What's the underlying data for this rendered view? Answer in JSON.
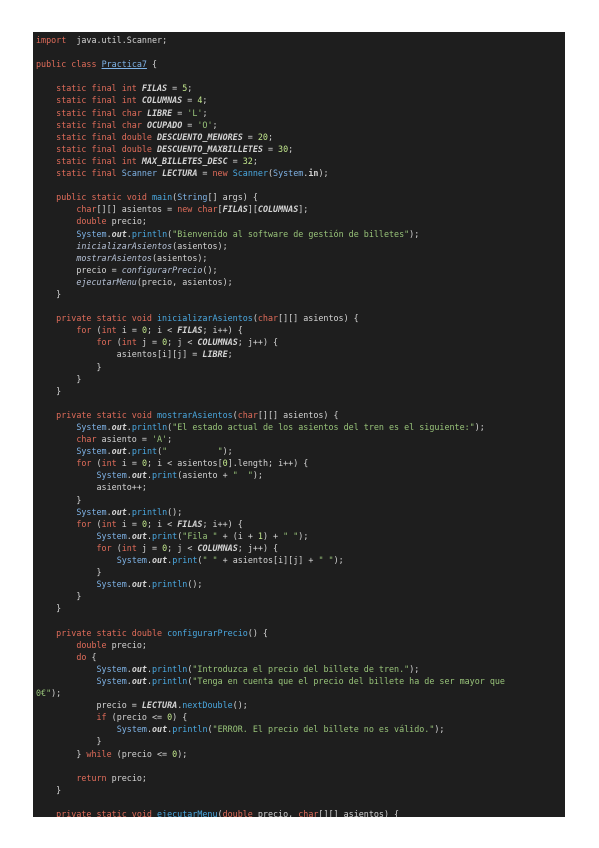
{
  "editor": {
    "language": "java",
    "colors": {
      "background": "#1e1e1e",
      "keyword": "#e06c5a",
      "string": "#98c379",
      "number": "#c3e88d",
      "method": "#4aa8e0",
      "class": "#7fb3e6",
      "plain": "#d4d4d4"
    },
    "lines": [
      [
        [
          "kw",
          "import"
        ],
        [
          "",
          "  java.util.Scanner;"
        ]
      ],
      [],
      [
        [
          "kw",
          "public class "
        ],
        [
          "cls ul",
          "Practica7"
        ],
        [
          "",
          " {"
        ]
      ],
      [],
      [
        [
          "",
          "    "
        ],
        [
          "kw",
          "static final int "
        ],
        [
          "cst",
          "FILAS"
        ],
        [
          "",
          " = "
        ],
        [
          "num",
          "5"
        ],
        [
          "",
          ";"
        ]
      ],
      [
        [
          "",
          "    "
        ],
        [
          "kw",
          "static final int "
        ],
        [
          "cst",
          "COLUMNAS"
        ],
        [
          "",
          " = "
        ],
        [
          "num",
          "4"
        ],
        [
          "",
          ";"
        ]
      ],
      [
        [
          "",
          "    "
        ],
        [
          "kw",
          "static final char "
        ],
        [
          "cst",
          "LIBRE"
        ],
        [
          "",
          " = "
        ],
        [
          "str",
          "'L'"
        ],
        [
          "",
          ";"
        ]
      ],
      [
        [
          "",
          "    "
        ],
        [
          "kw",
          "static final char "
        ],
        [
          "cst",
          "OCUPADO"
        ],
        [
          "",
          " = "
        ],
        [
          "str",
          "'O'"
        ],
        [
          "",
          ";"
        ]
      ],
      [
        [
          "",
          "    "
        ],
        [
          "kw",
          "static final double "
        ],
        [
          "cst",
          "DESCUENTO_MENORES"
        ],
        [
          "",
          " = "
        ],
        [
          "num",
          "20"
        ],
        [
          "",
          ";"
        ]
      ],
      [
        [
          "",
          "    "
        ],
        [
          "kw",
          "static final double "
        ],
        [
          "cst",
          "DESCUENTO_MAXBILLETES"
        ],
        [
          "",
          " = "
        ],
        [
          "num",
          "30"
        ],
        [
          "",
          ";"
        ]
      ],
      [
        [
          "",
          "    "
        ],
        [
          "kw",
          "static final int "
        ],
        [
          "cst",
          "MAX_BILLETES_DESC"
        ],
        [
          "",
          " = "
        ],
        [
          "num",
          "32"
        ],
        [
          "",
          ";"
        ]
      ],
      [
        [
          "",
          "    "
        ],
        [
          "kw",
          "static final "
        ],
        [
          "cls",
          "Scanner"
        ],
        [
          "cst",
          " LECTURA"
        ],
        [
          "",
          " = "
        ],
        [
          "kw",
          "new "
        ],
        [
          "fn",
          "Scanner"
        ],
        [
          "",
          "("
        ],
        [
          "cls",
          "System"
        ],
        [
          "",
          "."
        ],
        [
          "bold",
          "in"
        ],
        [
          "",
          ");"
        ]
      ],
      [],
      [
        [
          "",
          "    "
        ],
        [
          "kw",
          "public static void "
        ],
        [
          "fn",
          "main"
        ],
        [
          "",
          "("
        ],
        [
          "cls",
          "String"
        ],
        [
          "",
          "[] args) {"
        ]
      ],
      [
        [
          "",
          "        "
        ],
        [
          "ty",
          "char"
        ],
        [
          "",
          "[][] asientos = "
        ],
        [
          "kw",
          "new "
        ],
        [
          "ty",
          "char"
        ],
        [
          "",
          "["
        ],
        [
          "cst",
          "FILAS"
        ],
        [
          "",
          "]["
        ],
        [
          "cst",
          "COLUMNAS"
        ],
        [
          "",
          "];"
        ]
      ],
      [
        [
          "",
          "        "
        ],
        [
          "ty",
          "double"
        ],
        [
          "",
          " precio;"
        ]
      ],
      [
        [
          "",
          "        "
        ],
        [
          "cls",
          "System"
        ],
        [
          "",
          "."
        ],
        [
          "cst",
          "out"
        ],
        [
          "",
          "."
        ],
        [
          "fn",
          "println"
        ],
        [
          "",
          "("
        ],
        [
          "str",
          "\"Bienvenido al software de gestión de billetes\""
        ],
        [
          "",
          ");"
        ]
      ],
      [
        [
          "",
          "        "
        ],
        [
          "fni",
          "inicializarAsientos"
        ],
        [
          "",
          "(asientos);"
        ]
      ],
      [
        [
          "",
          "        "
        ],
        [
          "fni",
          "mostrarAsientos"
        ],
        [
          "",
          "(asientos);"
        ]
      ],
      [
        [
          "",
          "        precio = "
        ],
        [
          "fni",
          "configurarPrecio"
        ],
        [
          "",
          "();"
        ]
      ],
      [
        [
          "",
          "        "
        ],
        [
          "fni",
          "ejecutarMenu"
        ],
        [
          "",
          "(precio, asientos);"
        ]
      ],
      [
        [
          "",
          "    }"
        ]
      ],
      [],
      [
        [
          "",
          "    "
        ],
        [
          "kw",
          "private static void "
        ],
        [
          "fn",
          "inicializarAsientos"
        ],
        [
          "",
          "("
        ],
        [
          "ty",
          "char"
        ],
        [
          "",
          "[][] asientos) {"
        ]
      ],
      [
        [
          "",
          "        "
        ],
        [
          "kw",
          "for"
        ],
        [
          "",
          " ("
        ],
        [
          "ty",
          "int"
        ],
        [
          "",
          " i = "
        ],
        [
          "num",
          "0"
        ],
        [
          "",
          "; i < "
        ],
        [
          "cst",
          "FILAS"
        ],
        [
          "",
          "; i++) {"
        ]
      ],
      [
        [
          "",
          "            "
        ],
        [
          "kw",
          "for"
        ],
        [
          "",
          " ("
        ],
        [
          "ty",
          "int"
        ],
        [
          "",
          " j = "
        ],
        [
          "num",
          "0"
        ],
        [
          "",
          "; j < "
        ],
        [
          "cst",
          "COLUMNAS"
        ],
        [
          "",
          "; j++) {"
        ]
      ],
      [
        [
          "",
          "                asientos[i][j] = "
        ],
        [
          "cst",
          "LIBRE"
        ],
        [
          "",
          ";"
        ]
      ],
      [
        [
          "",
          "            }"
        ]
      ],
      [
        [
          "",
          "        }"
        ]
      ],
      [
        [
          "",
          "    }"
        ]
      ],
      [],
      [
        [
          "",
          "    "
        ],
        [
          "kw",
          "private static void "
        ],
        [
          "fn",
          "mostrarAsientos"
        ],
        [
          "",
          "("
        ],
        [
          "ty",
          "char"
        ],
        [
          "",
          "[][] asientos) {"
        ]
      ],
      [
        [
          "",
          "        "
        ],
        [
          "cls",
          "System"
        ],
        [
          "",
          "."
        ],
        [
          "cst",
          "out"
        ],
        [
          "",
          "."
        ],
        [
          "fn",
          "println"
        ],
        [
          "",
          "("
        ],
        [
          "str",
          "\"El estado actual de los asientos del tren es el siguiente:\""
        ],
        [
          "",
          ");"
        ]
      ],
      [
        [
          "",
          "        "
        ],
        [
          "ty",
          "char"
        ],
        [
          "",
          " asiento = "
        ],
        [
          "str",
          "'A'"
        ],
        [
          "",
          ";"
        ]
      ],
      [
        [
          "",
          "        "
        ],
        [
          "cls",
          "System"
        ],
        [
          "",
          "."
        ],
        [
          "cst",
          "out"
        ],
        [
          "",
          "."
        ],
        [
          "fn",
          "print"
        ],
        [
          "",
          "("
        ],
        [
          "str",
          "\"          \""
        ],
        [
          "",
          ");"
        ]
      ],
      [
        [
          "",
          "        "
        ],
        [
          "kw",
          "for"
        ],
        [
          "",
          " ("
        ],
        [
          "ty",
          "int"
        ],
        [
          "",
          " i = "
        ],
        [
          "num",
          "0"
        ],
        [
          "",
          "; i < asientos["
        ],
        [
          "num",
          "0"
        ],
        [
          "",
          "].length; i++) {"
        ]
      ],
      [
        [
          "",
          "            "
        ],
        [
          "cls",
          "System"
        ],
        [
          "",
          "."
        ],
        [
          "cst",
          "out"
        ],
        [
          "",
          "."
        ],
        [
          "fn",
          "print"
        ],
        [
          "",
          "(asiento + "
        ],
        [
          "str",
          "\"  \""
        ],
        [
          "",
          ");"
        ]
      ],
      [
        [
          "",
          "            asiento++;"
        ]
      ],
      [
        [
          "",
          "        }"
        ]
      ],
      [
        [
          "",
          "        "
        ],
        [
          "cls",
          "System"
        ],
        [
          "",
          "."
        ],
        [
          "cst",
          "out"
        ],
        [
          "",
          "."
        ],
        [
          "fn",
          "println"
        ],
        [
          "",
          "();"
        ]
      ],
      [
        [
          "",
          "        "
        ],
        [
          "kw",
          "for"
        ],
        [
          "",
          " ("
        ],
        [
          "ty",
          "int"
        ],
        [
          "",
          " i = "
        ],
        [
          "num",
          "0"
        ],
        [
          "",
          "; i < "
        ],
        [
          "cst",
          "FILAS"
        ],
        [
          "",
          "; i++) {"
        ]
      ],
      [
        [
          "",
          "            "
        ],
        [
          "cls",
          "System"
        ],
        [
          "",
          "."
        ],
        [
          "cst",
          "out"
        ],
        [
          "",
          "."
        ],
        [
          "fn",
          "print"
        ],
        [
          "",
          "("
        ],
        [
          "str",
          "\"Fila \""
        ],
        [
          "",
          " + (i + "
        ],
        [
          "num",
          "1"
        ],
        [
          "",
          ") + "
        ],
        [
          "str",
          "\" \""
        ],
        [
          "",
          ");"
        ]
      ],
      [
        [
          "",
          "            "
        ],
        [
          "kw",
          "for"
        ],
        [
          "",
          " ("
        ],
        [
          "ty",
          "int"
        ],
        [
          "",
          " j = "
        ],
        [
          "num",
          "0"
        ],
        [
          "",
          "; j < "
        ],
        [
          "cst",
          "COLUMNAS"
        ],
        [
          "",
          "; j++) {"
        ]
      ],
      [
        [
          "",
          "                "
        ],
        [
          "cls",
          "System"
        ],
        [
          "",
          "."
        ],
        [
          "cst",
          "out"
        ],
        [
          "",
          "."
        ],
        [
          "fn",
          "print"
        ],
        [
          "",
          "("
        ],
        [
          "str",
          "\" \""
        ],
        [
          "",
          " + asientos[i][j] + "
        ],
        [
          "str",
          "\" \""
        ],
        [
          "",
          ");"
        ]
      ],
      [
        [
          "",
          "            }"
        ]
      ],
      [
        [
          "",
          "            "
        ],
        [
          "cls",
          "System"
        ],
        [
          "",
          "."
        ],
        [
          "cst",
          "out"
        ],
        [
          "",
          "."
        ],
        [
          "fn",
          "println"
        ],
        [
          "",
          "();"
        ]
      ],
      [
        [
          "",
          "        }"
        ]
      ],
      [
        [
          "",
          "    }"
        ]
      ],
      [],
      [
        [
          "",
          "    "
        ],
        [
          "kw",
          "private static double "
        ],
        [
          "fn",
          "configurarPrecio"
        ],
        [
          "",
          "() {"
        ]
      ],
      [
        [
          "",
          "        "
        ],
        [
          "ty",
          "double"
        ],
        [
          "",
          " precio;"
        ]
      ],
      [
        [
          "",
          "        "
        ],
        [
          "kw",
          "do"
        ],
        [
          "",
          " {"
        ]
      ],
      [
        [
          "",
          "            "
        ],
        [
          "cls",
          "System"
        ],
        [
          "",
          "."
        ],
        [
          "cst",
          "out"
        ],
        [
          "",
          "."
        ],
        [
          "fn",
          "println"
        ],
        [
          "",
          "("
        ],
        [
          "str",
          "\"Introduzca el precio del billete de tren.\""
        ],
        [
          "",
          ");"
        ]
      ],
      [
        [
          "",
          "            "
        ],
        [
          "cls",
          "System"
        ],
        [
          "",
          "."
        ],
        [
          "cst",
          "out"
        ],
        [
          "",
          "."
        ],
        [
          "fn",
          "println"
        ],
        [
          "",
          "("
        ],
        [
          "str",
          "\"Tenga en cuenta que el precio del billete ha de ser mayor que"
        ]
      ],
      [
        [
          "str",
          "0€\""
        ],
        [
          "",
          ");"
        ]
      ],
      [
        [
          "",
          "            precio = "
        ],
        [
          "cst",
          "LECTURA"
        ],
        [
          "",
          "."
        ],
        [
          "fn",
          "nextDouble"
        ],
        [
          "",
          "();"
        ]
      ],
      [
        [
          "",
          "            "
        ],
        [
          "kw",
          "if"
        ],
        [
          "",
          " (precio <= "
        ],
        [
          "num",
          "0"
        ],
        [
          "",
          ") {"
        ]
      ],
      [
        [
          "",
          "                "
        ],
        [
          "cls",
          "System"
        ],
        [
          "",
          "."
        ],
        [
          "cst",
          "out"
        ],
        [
          "",
          "."
        ],
        [
          "fn",
          "println"
        ],
        [
          "",
          "("
        ],
        [
          "str",
          "\"ERROR. El precio del billete no es válido.\""
        ],
        [
          "",
          ");"
        ]
      ],
      [
        [
          "",
          "            }"
        ]
      ],
      [
        [
          "",
          "        } "
        ],
        [
          "kw",
          "while"
        ],
        [
          "",
          " (precio <= "
        ],
        [
          "num",
          "0"
        ],
        [
          "",
          ");"
        ]
      ],
      [],
      [
        [
          "",
          "        "
        ],
        [
          "kw",
          "return"
        ],
        [
          "",
          " precio;"
        ]
      ],
      [
        [
          "",
          "    }"
        ]
      ],
      [],
      [
        [
          "",
          "    "
        ],
        [
          "kw",
          "private static void "
        ],
        [
          "fn",
          "ejecutarMenu"
        ],
        [
          "",
          "("
        ],
        [
          "ty",
          "double"
        ],
        [
          "",
          " precio, "
        ],
        [
          "ty",
          "char"
        ],
        [
          "",
          "[][] asientos) {"
        ]
      ]
    ]
  }
}
